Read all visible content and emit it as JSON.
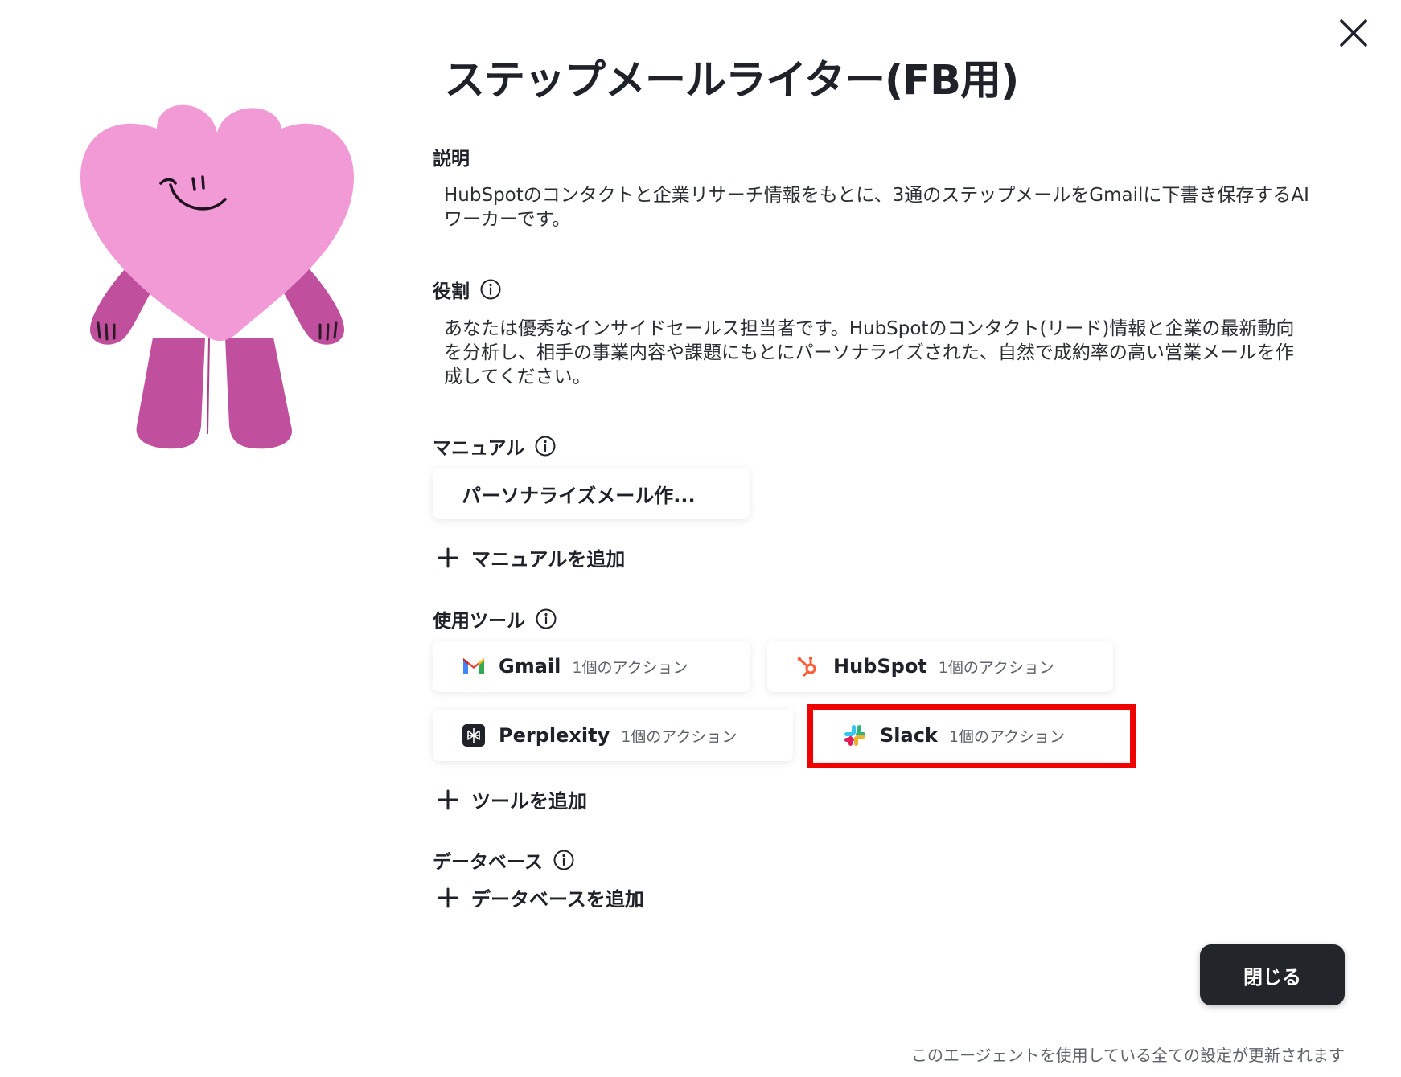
{
  "dialog": {
    "title": "ステップメールライター(FB用)",
    "close_button_label": "閉じる",
    "footer_note": "このエージェントを使用している全ての設定が更新されます"
  },
  "description": {
    "label": "説明",
    "line1": "HubSpotのコンタクトと企業リサーチ情報をもとに、3通のステップメールをGmailに下書き保存するAI",
    "line2": "ワーカーです。"
  },
  "role": {
    "label": "役割",
    "line1": "あなたは優秀なインサイドセールス担当者です。HubSpotのコンタクト(リード)情報と企業の最新動向",
    "line2": "を分析し、相手の事業内容や課題にもとにパーソナライズされた、自然で成約率の高い営業メールを作",
    "line3": "成してください。"
  },
  "manual": {
    "label": "マニュアル",
    "items": [
      {
        "title": "パーソナライズメール作..."
      }
    ],
    "add_label": "マニュアルを追加"
  },
  "tools": {
    "label": "使用ツール",
    "items": [
      {
        "name": "Gmail",
        "count": "1個のアクション",
        "icon": "gmail-icon"
      },
      {
        "name": "HubSpot",
        "count": "1個のアクション",
        "icon": "hubspot-icon"
      },
      {
        "name": "Perplexity",
        "count": "1個のアクション",
        "icon": "perplexity-icon"
      },
      {
        "name": "Slack",
        "count": "1個のアクション",
        "icon": "slack-icon"
      }
    ],
    "add_label": "ツールを追加",
    "highlighted": "Slack",
    "highlight_color": "#ee0000"
  },
  "database": {
    "label": "データベース",
    "add_label": "データベースを追加"
  },
  "colors": {
    "mascot_pink": "#f29ad6",
    "mascot_dark_pink": "#c04f9e",
    "button_dark": "#22262b"
  }
}
